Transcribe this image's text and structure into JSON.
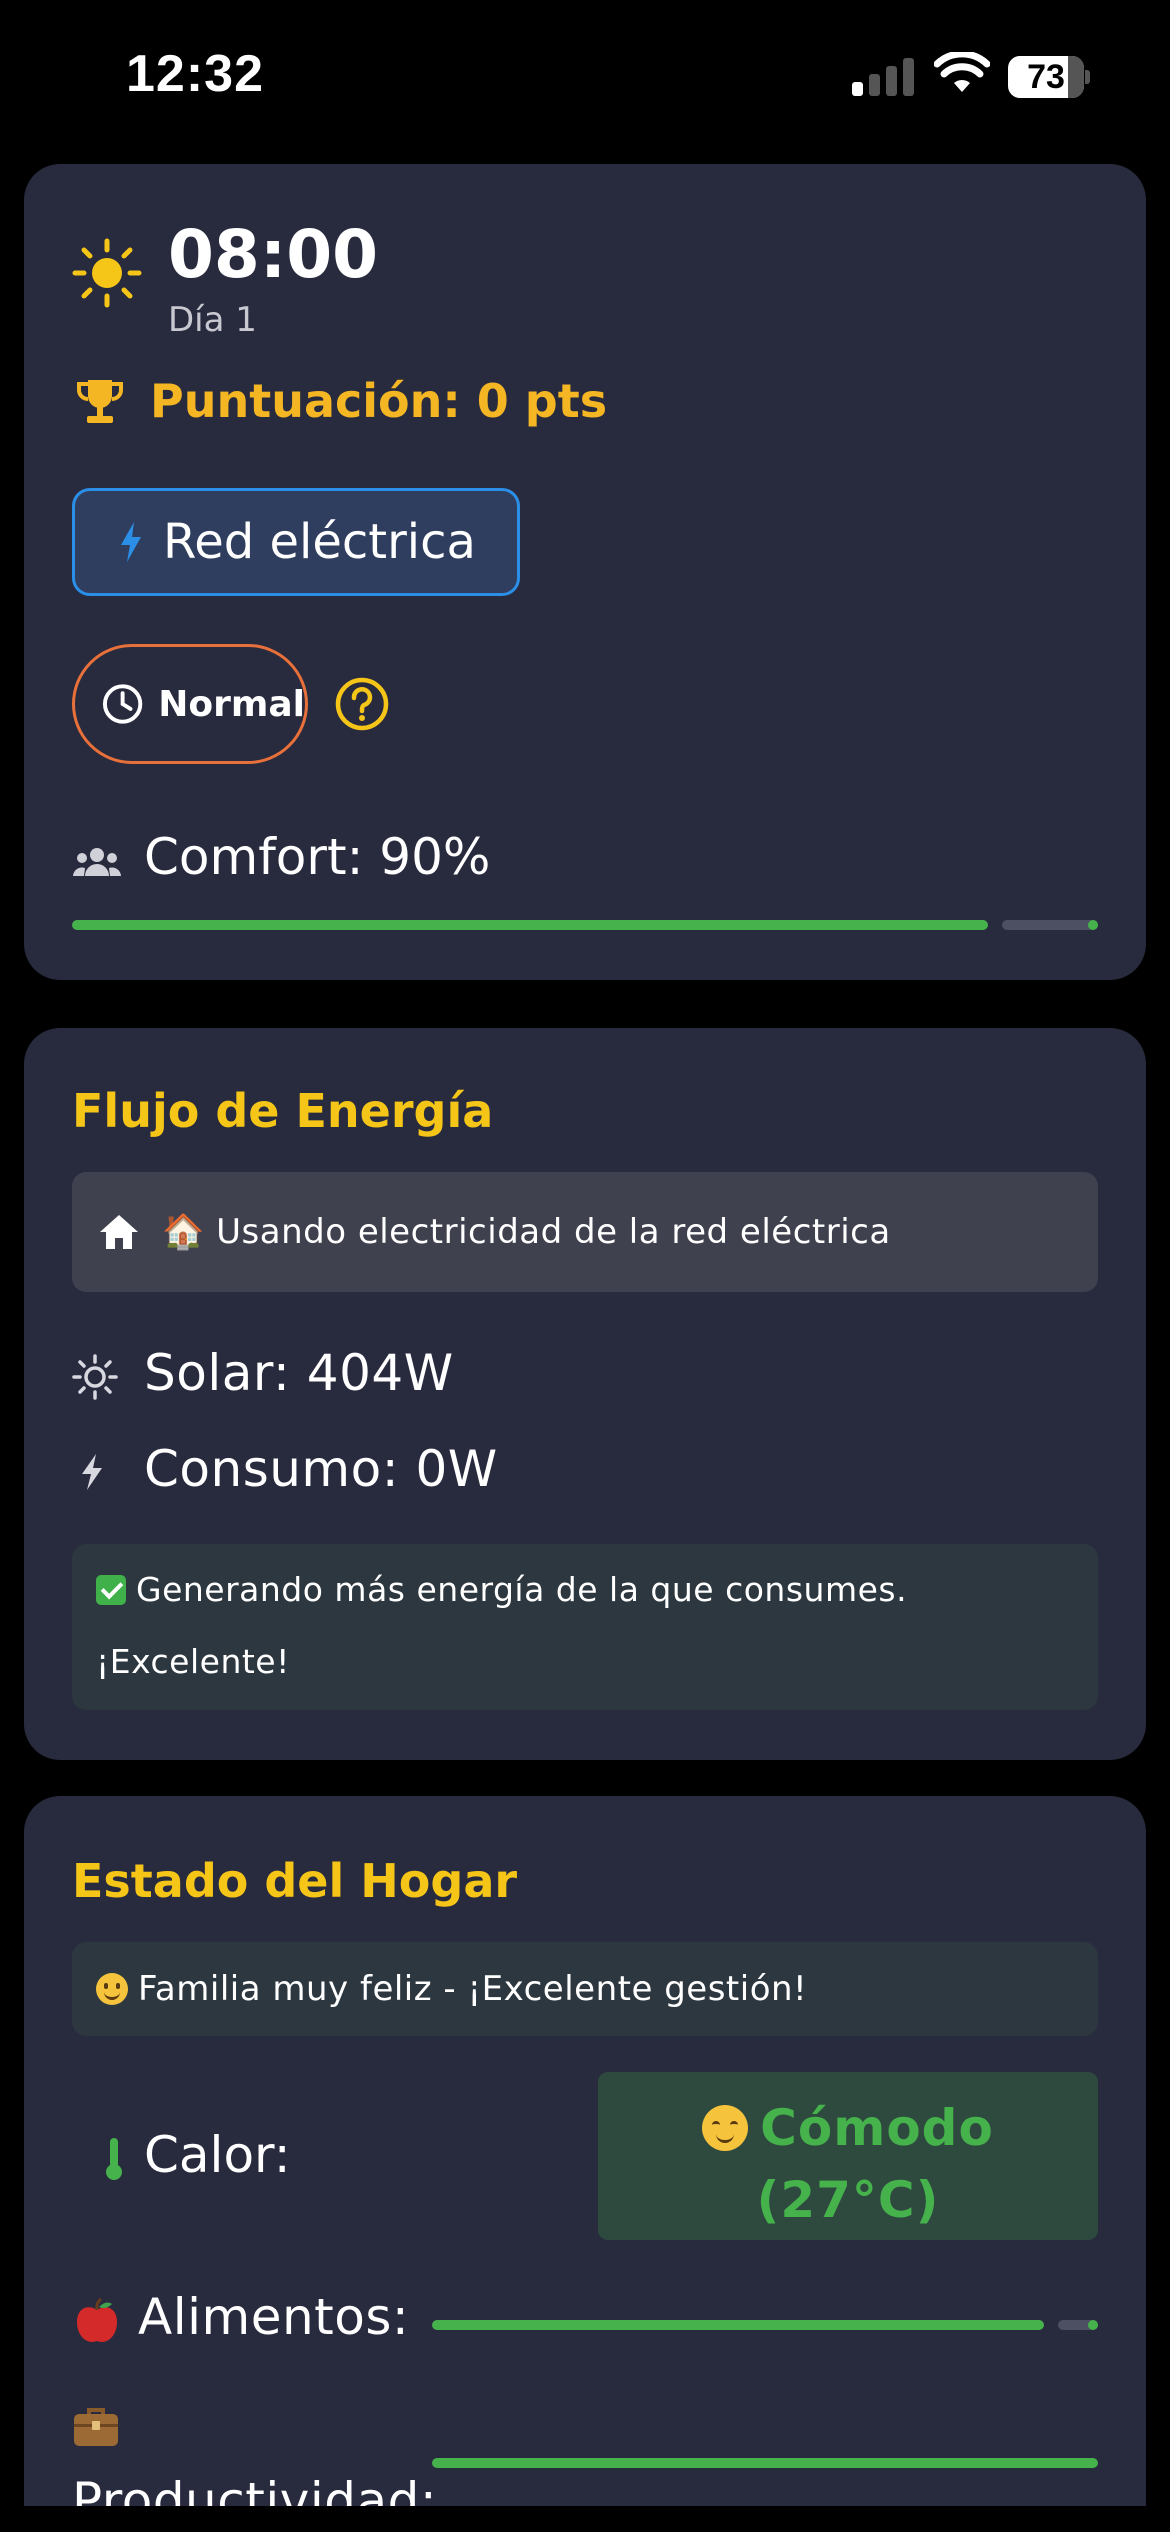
{
  "status_bar": {
    "time": "12:32",
    "battery_level": "73",
    "signal_bars_active": 1,
    "signal_bars_total": 4
  },
  "header_card": {
    "time": "08:00",
    "day": "Día 1",
    "score": "Puntuación: 0 pts",
    "power_source_button": "Red eléctrica",
    "mode_label": "Normal",
    "comfort_label": "Comfort: 90%",
    "comfort_value": 0.9,
    "icons": {
      "weather": "sun-icon",
      "score": "trophy-icon",
      "power_source": "bolt-icon",
      "mode": "clock-icon",
      "help": "help-icon",
      "comfort": "people-icon"
    }
  },
  "energy_card": {
    "title": "Flujo de Energía",
    "flow_status": "🏠 Usando electricidad de la red eléctrica",
    "solar": "Solar: 404W",
    "consumption": "Consumo: 0W",
    "message_line1": "Generando más energía de la que consumes.",
    "message_line2": "¡Excelente!"
  },
  "home_card": {
    "title": "Estado del Hogar",
    "family_status": "Familia muy feliz - ¡Excelente gestión!",
    "heat_label": "Calor:",
    "heat_status_line1": "Cómodo",
    "heat_status_line2": "(27°C)",
    "food_label": "Alimentos:",
    "food_value": 0.93,
    "productivity_label": "Productividad:",
    "productivity_value": 1.0
  },
  "colors": {
    "background": "#000000",
    "card": "#282a3e",
    "accent_yellow": "#f5c518",
    "score_orange": "#f5b623",
    "blue": "#2b8fe8",
    "orange_border": "#e8703a",
    "green": "#46b24c"
  }
}
